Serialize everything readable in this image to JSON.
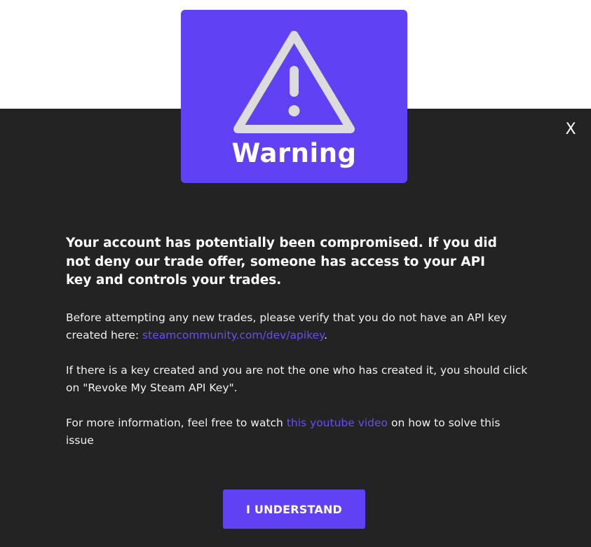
{
  "warning": {
    "title": "Warning",
    "icon": "warning-triangle-icon"
  },
  "close": {
    "label": "X"
  },
  "message": {
    "headline": "Your account has potentially been compromised. If you did not deny our trade offer, someone has access to your API key and controls your trades.",
    "p1_before": "Before attempting any new trades, please verify that you do not have an API key created here: ",
    "p1_link": "steamcommunity.com/dev/apikey",
    "p1_after": ".",
    "p2": "If there is a key created and you are not the one who has created it, you should click on \"Revoke My Steam API Key\".",
    "p3_before": "For more information, feel free to watch ",
    "p3_link": "this youtube video",
    "p3_after": " on how to solve this issue"
  },
  "button": {
    "label": "I UNDERSTAND"
  },
  "colors": {
    "accent": "#6041f3",
    "link": "#6a4cf6",
    "modal_bg": "#232323",
    "page_bg": "#ffffff"
  }
}
